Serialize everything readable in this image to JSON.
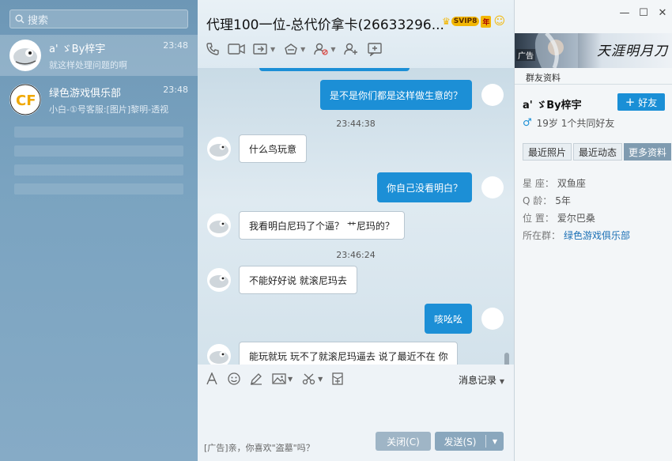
{
  "left": {
    "search_placeholder": "搜索",
    "contacts": [
      {
        "name": "a' ゞBy梓宇",
        "preview": "就这样处理问题的啊",
        "time": "23:48",
        "active": true
      },
      {
        "name": "绿色游戏俱乐部",
        "preview": "小白-①号客服:[图片]黎明-透视",
        "time": "23:48",
        "active": false
      }
    ]
  },
  "chat": {
    "title": "代理100一位-总代价拿卡(26633296...",
    "badges": {
      "svip": "SVIP8",
      "year": "年"
    },
    "toolbar_icons": [
      "phone-icon",
      "video-icon",
      "share-screen-icon",
      "remote-assist-icon",
      "block-user-icon",
      "add-user-icon",
      "edit-icon"
    ],
    "messages": [
      {
        "type": "out",
        "text": "是不是你们都是这样做生意的？"
      },
      {
        "type": "time",
        "text": "23:44:38"
      },
      {
        "type": "in",
        "text": "什么鸟玩意"
      },
      {
        "type": "out",
        "text": "你自己没看明白？"
      },
      {
        "type": "in",
        "text": "我看明白尼玛了个逼？      艹尼玛的？"
      },
      {
        "type": "time",
        "text": "23:46:24"
      },
      {
        "type": "in",
        "text": "不能好好说 就滚尼玛去"
      },
      {
        "type": "out",
        "text": "咳吆吆"
      },
      {
        "type": "in",
        "text": "能玩就玩  玩不了就滚尼玛逼去   说了最近不在 你"
      }
    ],
    "input": {
      "toolbar_icons": [
        "font-icon",
        "emoji-icon",
        "pen-icon",
        "image-icon",
        "scissors-icon",
        "red-packet-icon"
      ],
      "message_record": "消息记录",
      "ad_text": "[广告]亲，你喜欢\"盗墓\"吗？",
      "close_label": "关闭(C)",
      "send_label": "发送(S)"
    }
  },
  "right": {
    "window_controls": [
      "—",
      "☐",
      "✕"
    ],
    "banner": {
      "ad_tag": "广告",
      "text": "天涯明月刀"
    },
    "group_info_label": "群友资料",
    "profile_name": "a' ゞBy梓宇",
    "add_friend_label": "好友",
    "age_text": "19岁  1个共同好友",
    "tabs": [
      {
        "label": "最近照片",
        "active": false
      },
      {
        "label": "最近动态",
        "active": false
      },
      {
        "label": "更多资料",
        "active": true
      }
    ],
    "info": [
      {
        "key": "星    座：",
        "value": "双鱼座",
        "link": false
      },
      {
        "key": "Q      龄：",
        "value": "5年",
        "link": false
      },
      {
        "key": "位    置：",
        "value": "爱尔巴桑",
        "link": false
      },
      {
        "key": "所在群：",
        "value": "绿色游戏俱乐部",
        "link": true
      }
    ]
  },
  "colors": {
    "accent": "#1a8fd6",
    "outgoing_bubble": "#1c8fd6",
    "left_panel": "#7aa3c0"
  }
}
